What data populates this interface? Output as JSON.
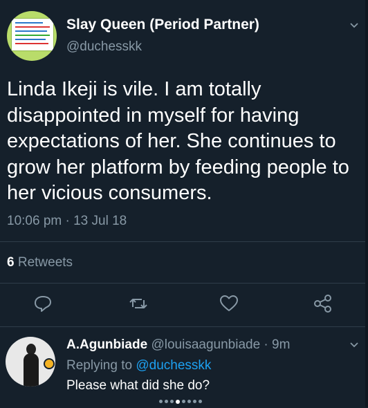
{
  "tweet": {
    "display_name": "Slay Queen (Period Partner)",
    "handle": "@duchesskk",
    "text": "Linda Ikeji is vile. I am totally disappointed in myself for having expectations of her. She continues to grow her platform by feeding people to her vicious consumers.",
    "timestamp": "10:06 pm · 13 Jul 18",
    "retweet_count": "6",
    "retweet_label": "Retweets",
    "actions": [
      "reply-icon",
      "retweet-icon",
      "like-icon",
      "share-icon"
    ]
  },
  "reply": {
    "display_name": "A.Agunbiade",
    "handle": "@louisaagunbiade",
    "time": "· 9m",
    "replying_to_prefix": "Replying to",
    "replying_to_handle": "@duchesskk",
    "text": "Please what did she do?"
  },
  "carousel": {
    "count": 8,
    "active_index": 3
  },
  "colors": {
    "background": "#15202b",
    "secondary_text": "#8899a6",
    "link": "#1da1f2",
    "divider": "#2f3d4a"
  }
}
